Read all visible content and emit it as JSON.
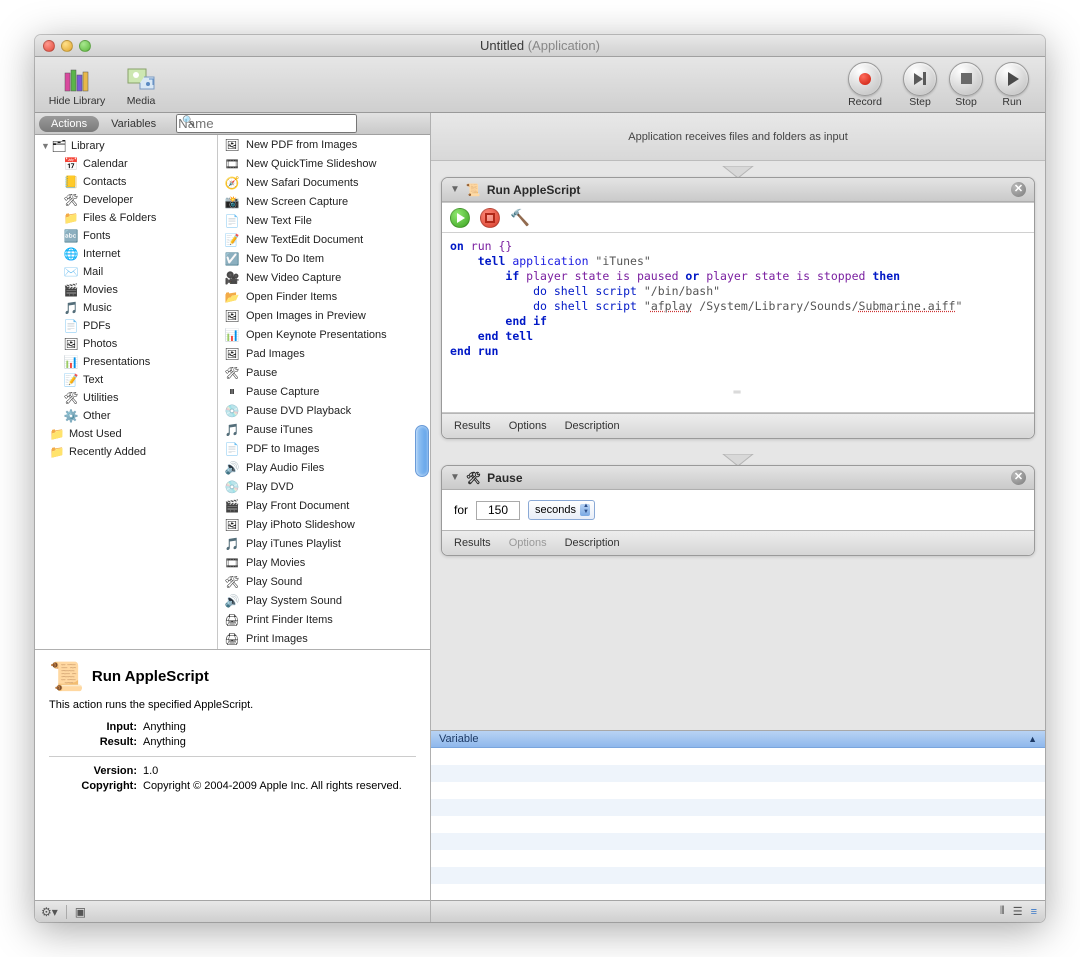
{
  "window": {
    "title": "Untitled",
    "subtitle": "(Application)"
  },
  "toolbar": {
    "hide_library": "Hide Library",
    "media": "Media",
    "record": "Record",
    "step": "Step",
    "stop": "Stop",
    "run": "Run"
  },
  "tabs": {
    "actions": "Actions",
    "variables": "Variables"
  },
  "search_placeholder": "Name",
  "library": {
    "root": "Library",
    "categories": [
      "Calendar",
      "Contacts",
      "Developer",
      "Files & Folders",
      "Fonts",
      "Internet",
      "Mail",
      "Movies",
      "Music",
      "PDFs",
      "Photos",
      "Presentations",
      "Text",
      "Utilities",
      "Other"
    ],
    "most_used": "Most Used",
    "recently_added": "Recently Added"
  },
  "actions_list": [
    "New PDF from Images",
    "New QuickTime Slideshow",
    "New Safari Documents",
    "New Screen Capture",
    "New Text File",
    "New TextEdit Document",
    "New To Do Item",
    "New Video Capture",
    "Open Finder Items",
    "Open Images in Preview",
    "Open Keynote Presentations",
    "Pad Images",
    "Pause",
    "Pause Capture",
    "Pause DVD Playback",
    "Pause iTunes",
    "PDF to Images",
    "Play Audio Files",
    "Play DVD",
    "Play Front Document",
    "Play iPhoto Slideshow",
    "Play iTunes Playlist",
    "Play Movies",
    "Play Sound",
    "Play System Sound",
    "Print Finder Items",
    "Print Images"
  ],
  "info": {
    "title": "Run AppleScript",
    "desc": "This action runs the specified AppleScript.",
    "input_k": "Input:",
    "input_v": "Anything",
    "result_k": "Result:",
    "result_v": "Anything",
    "version_k": "Version:",
    "version_v": "1.0",
    "copyright_k": "Copyright:",
    "copyright_v": "Copyright © 2004-2009 Apple Inc.  All rights reserved."
  },
  "workflow": {
    "drop_hint": "Application receives files and folders as input",
    "action1": {
      "title": "Run AppleScript",
      "code_lines": {
        "l1a": "on",
        "l1b": " run {}",
        "l2a": "tell",
        "l2b": " application ",
        "l2c": "\"iTunes\"",
        "l3a": "if",
        "l3b": " player state is paused ",
        "l3c": "or",
        "l3d": " player state is stopped ",
        "l3e": "then",
        "l4a": "do shell script",
        "l4b": " \"/bin/bash\"",
        "l5a": "do shell script",
        "l5b": " \"",
        "l5c": "afplay",
        "l5d": " /System/Library/Sounds/",
        "l5e": "Submarine.aiff",
        "l5f": "\"",
        "l6": "end if",
        "l7": "end tell",
        "l8": "end run"
      },
      "footer": {
        "results": "Results",
        "options": "Options",
        "description": "Description"
      }
    },
    "action2": {
      "title": "Pause",
      "for_label": "for",
      "value": "150",
      "unit": "seconds",
      "footer": {
        "results": "Results",
        "options": "Options",
        "description": "Description"
      }
    }
  },
  "variables_header": "Variable"
}
